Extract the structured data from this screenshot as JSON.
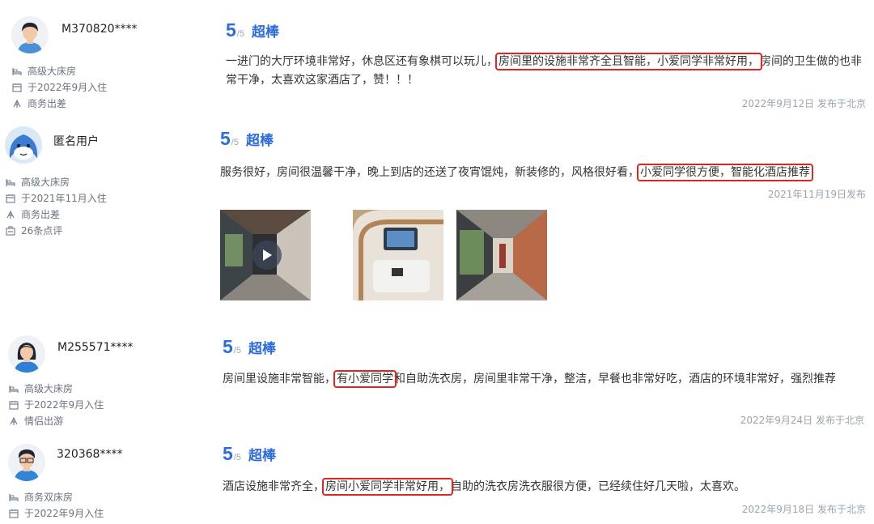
{
  "colors": {
    "accent": "#2d6cdf",
    "highlight_box": "#e02424",
    "meta_text": "#6b7280",
    "date_text": "#9aa3ad"
  },
  "reviews": [
    {
      "username": "M370820****",
      "avatar": "male-avatar-icon",
      "meta": [
        "高级大床房",
        "于2022年9月入住",
        "商务出差"
      ],
      "score": "5",
      "score_max": "/5",
      "rating_label": "超棒",
      "text_before": "一进门的大厅环境非常好，休息区还有象棋可以玩儿，",
      "text_highlight": "房间里的设施非常齐全且智能，小爱同学非常好用，",
      "text_after": "房间的卫生做的也非常干净，太喜欢这家酒店了，赞！！！",
      "date": "2022年9月12日 发布于北京"
    },
    {
      "username": "匿名用户",
      "avatar": "dolphin-avatar-icon",
      "meta": [
        "高级大床房",
        "于2021年11月入住",
        "商务出差",
        "26条点评"
      ],
      "score": "5",
      "score_max": "/5",
      "rating_label": "超棒",
      "text_before": "服务很好，房间很温馨干净，晚上到店的还送了夜宵馄炖，新装修的，风格很好看，",
      "text_highlight": "小爱同学很方便，智能化酒店推荐",
      "text_after": "",
      "date": "2021年11月19日发布",
      "photos": [
        "corridor-video",
        "smart-screen-desk",
        "hallway-window"
      ]
    },
    {
      "username": "M255571****",
      "avatar": "female-avatar-icon",
      "meta": [
        "高级大床房",
        "于2022年9月入住",
        "情侣出游"
      ],
      "score": "5",
      "score_max": "/5",
      "rating_label": "超棒",
      "text_before": "房间里设施非常智能，",
      "text_highlight": "有小爱同学",
      "text_after": "和自助洗衣房，房间里非常干净，整洁，早餐也非常好吃，酒店的环境非常好，强烈推荐",
      "date": "2022年9月24日 发布于北京"
    },
    {
      "username": "320368****",
      "avatar": "male-avatar-icon",
      "meta": [
        "商务双床房",
        "于2022年9月入住"
      ],
      "score": "5",
      "score_max": "/5",
      "rating_label": "超棒",
      "text_before": "酒店设施非常齐全，",
      "text_highlight": "房间小爱同学非常好用，",
      "text_after": "自助的洗衣房洗衣服很方便，已经续住好几天啦，太喜欢。",
      "date": "2022年9月18日 发布于北京"
    }
  ]
}
